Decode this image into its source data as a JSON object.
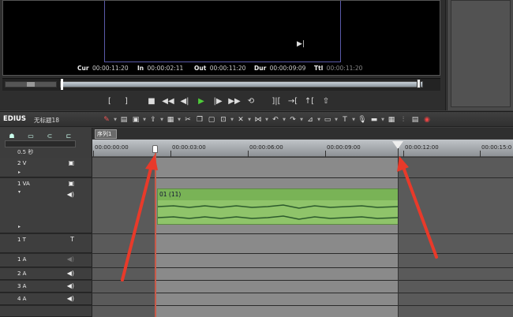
{
  "preview": {
    "timecodes": {
      "cur": {
        "label": "Cur",
        "value": "00:00:11:20"
      },
      "in": {
        "label": "In",
        "value": "00:00:02:11"
      },
      "out": {
        "label": "Out",
        "value": "00:00:11:20"
      },
      "dur": {
        "label": "Dur",
        "value": "00:00:09:09"
      },
      "ttl": {
        "label": "Ttl",
        "value": "00:00:11:20"
      }
    },
    "transport_icons": [
      "set-in-icon",
      "set-out-icon",
      "stop-icon",
      "rewind-icon",
      "step-back-icon",
      "play-icon",
      "step-forward-icon",
      "fast-forward-icon",
      "loop-icon",
      "insert-icon",
      "overwrite-icon",
      "extract-icon",
      "lift-icon"
    ]
  },
  "app": {
    "name": "EDIUS",
    "project": "无标题18"
  },
  "timeline": {
    "scale_label": "0.5 秒",
    "sequence_tab": "序列1",
    "ruler": [
      "00:00:00:00",
      "00:00:03:00",
      "00:00:06:00",
      "00:00:09:00",
      "00:00:12:00",
      "00:00:15:0"
    ],
    "tracks": [
      {
        "name": "2 V"
      },
      {
        "name": "1 VA"
      },
      {
        "name": "1 T"
      },
      {
        "name": "1 A"
      },
      {
        "name": "2 A"
      },
      {
        "name": "3 A"
      },
      {
        "name": "4 A"
      }
    ],
    "clip_label": "01 (11)"
  },
  "colors": {
    "annotation_arrow": "#e83a2a",
    "clip_green": "#8fc46a",
    "play_green": "#4ecc3a"
  }
}
